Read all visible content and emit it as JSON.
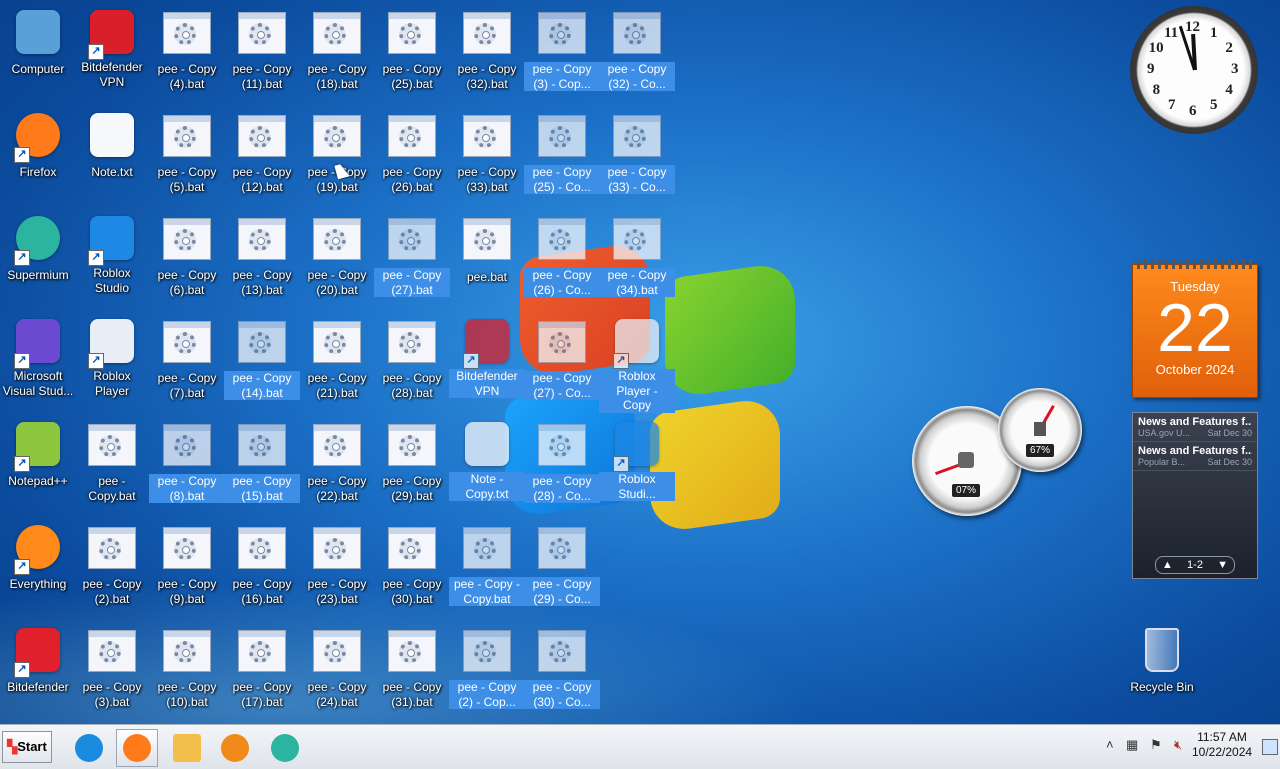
{
  "desktop": {
    "icons": [
      {
        "label": "Computer",
        "icon": "computer-icon",
        "col": 0,
        "row": 0,
        "sel": false,
        "sc": false
      },
      {
        "label": "Firefox",
        "icon": "firefox-icon",
        "col": 0,
        "row": 1,
        "sel": false,
        "sc": true
      },
      {
        "label": "Supermium",
        "icon": "supermium-icon",
        "col": 0,
        "row": 2,
        "sel": false,
        "sc": true
      },
      {
        "label": "Microsoft Visual Stud...",
        "icon": "visual-studio-icon",
        "col": 0,
        "row": 3,
        "sel": false,
        "sc": true
      },
      {
        "label": "Notepad++",
        "icon": "notepad-plus-plus-icon",
        "col": 0,
        "row": 4,
        "sel": false,
        "sc": true
      },
      {
        "label": "Everything",
        "icon": "everything-search-icon",
        "col": 0,
        "row": 5,
        "sel": false,
        "sc": true
      },
      {
        "label": "Bitdefender",
        "icon": "bitdefender-icon",
        "col": 0,
        "row": 6,
        "sel": false,
        "sc": true
      },
      {
        "label": "Bitdefender VPN",
        "icon": "bitdefender-vpn-icon",
        "col": 1,
        "row": 0,
        "sel": false,
        "sc": true
      },
      {
        "label": "Note.txt",
        "icon": "text-file-icon",
        "col": 1,
        "row": 1,
        "sel": false,
        "sc": false
      },
      {
        "label": "Roblox Studio",
        "icon": "roblox-studio-icon",
        "col": 1,
        "row": 2,
        "sel": false,
        "sc": true
      },
      {
        "label": "Roblox Player",
        "icon": "roblox-player-icon",
        "col": 1,
        "row": 3,
        "sel": false,
        "sc": true
      },
      {
        "label": "pee - Copy.bat",
        "icon": "bat-file-icon",
        "col": 1,
        "row": 4,
        "sel": false,
        "sc": false
      },
      {
        "label": "pee - Copy (2).bat",
        "icon": "bat-file-icon",
        "col": 1,
        "row": 5,
        "sel": false,
        "sc": false
      },
      {
        "label": "pee - Copy (3).bat",
        "icon": "bat-file-icon",
        "col": 1,
        "row": 6,
        "sel": false,
        "sc": false
      },
      {
        "label": "pee - Copy (4).bat",
        "icon": "bat-file-icon",
        "col": 2,
        "row": 0,
        "sel": false,
        "sc": false
      },
      {
        "label": "pee - Copy (5).bat",
        "icon": "bat-file-icon",
        "col": 2,
        "row": 1,
        "sel": false,
        "sc": false
      },
      {
        "label": "pee - Copy (6).bat",
        "icon": "bat-file-icon",
        "col": 2,
        "row": 2,
        "sel": false,
        "sc": false
      },
      {
        "label": "pee - Copy (7).bat",
        "icon": "bat-file-icon",
        "col": 2,
        "row": 3,
        "sel": false,
        "sc": false
      },
      {
        "label": "pee - Copy (8).bat",
        "icon": "bat-file-icon",
        "col": 2,
        "row": 4,
        "sel": true,
        "sc": false
      },
      {
        "label": "pee - Copy (9).bat",
        "icon": "bat-file-icon",
        "col": 2,
        "row": 5,
        "sel": false,
        "sc": false
      },
      {
        "label": "pee - Copy (10).bat",
        "icon": "bat-file-icon",
        "col": 2,
        "row": 6,
        "sel": false,
        "sc": false
      },
      {
        "label": "pee - Copy (11).bat",
        "icon": "bat-file-icon",
        "col": 3,
        "row": 0,
        "sel": false,
        "sc": false
      },
      {
        "label": "pee - Copy (12).bat",
        "icon": "bat-file-icon",
        "col": 3,
        "row": 1,
        "sel": false,
        "sc": false
      },
      {
        "label": "pee - Copy (13).bat",
        "icon": "bat-file-icon",
        "col": 3,
        "row": 2,
        "sel": false,
        "sc": false
      },
      {
        "label": "pee - Copy (14).bat",
        "icon": "bat-file-icon",
        "col": 3,
        "row": 3,
        "sel": true,
        "sc": false
      },
      {
        "label": "pee - Copy (15).bat",
        "icon": "bat-file-icon",
        "col": 3,
        "row": 4,
        "sel": true,
        "sc": false
      },
      {
        "label": "pee - Copy (16).bat",
        "icon": "bat-file-icon",
        "col": 3,
        "row": 5,
        "sel": false,
        "sc": false
      },
      {
        "label": "pee - Copy (17).bat",
        "icon": "bat-file-icon",
        "col": 3,
        "row": 6,
        "sel": false,
        "sc": false
      },
      {
        "label": "pee - Copy (18).bat",
        "icon": "bat-file-icon",
        "col": 4,
        "row": 0,
        "sel": false,
        "sc": false
      },
      {
        "label": "pee - Copy (19).bat",
        "icon": "bat-file-icon",
        "col": 4,
        "row": 1,
        "sel": false,
        "sc": false
      },
      {
        "label": "pee - Copy (20).bat",
        "icon": "bat-file-icon",
        "col": 4,
        "row": 2,
        "sel": false,
        "sc": false
      },
      {
        "label": "pee - Copy (21).bat",
        "icon": "bat-file-icon",
        "col": 4,
        "row": 3,
        "sel": false,
        "sc": false
      },
      {
        "label": "pee - Copy (22).bat",
        "icon": "bat-file-icon",
        "col": 4,
        "row": 4,
        "sel": false,
        "sc": false
      },
      {
        "label": "pee - Copy (23).bat",
        "icon": "bat-file-icon",
        "col": 4,
        "row": 5,
        "sel": false,
        "sc": false
      },
      {
        "label": "pee - Copy (24).bat",
        "icon": "bat-file-icon",
        "col": 4,
        "row": 6,
        "sel": false,
        "sc": false
      },
      {
        "label": "pee - Copy (25).bat",
        "icon": "bat-file-icon",
        "col": 5,
        "row": 0,
        "sel": false,
        "sc": false
      },
      {
        "label": "pee - Copy (26).bat",
        "icon": "bat-file-icon",
        "col": 5,
        "row": 1,
        "sel": false,
        "sc": false
      },
      {
        "label": "pee - Copy (27).bat",
        "icon": "bat-file-icon",
        "col": 5,
        "row": 2,
        "sel": true,
        "sc": false
      },
      {
        "label": "pee - Copy (28).bat",
        "icon": "bat-file-icon",
        "col": 5,
        "row": 3,
        "sel": false,
        "sc": false
      },
      {
        "label": "pee - Copy (29).bat",
        "icon": "bat-file-icon",
        "col": 5,
        "row": 4,
        "sel": false,
        "sc": false
      },
      {
        "label": "pee - Copy (30).bat",
        "icon": "bat-file-icon",
        "col": 5,
        "row": 5,
        "sel": false,
        "sc": false
      },
      {
        "label": "pee - Copy (31).bat",
        "icon": "bat-file-icon",
        "col": 5,
        "row": 6,
        "sel": false,
        "sc": false
      },
      {
        "label": "pee - Copy (32).bat",
        "icon": "bat-file-icon",
        "col": 6,
        "row": 0,
        "sel": false,
        "sc": false
      },
      {
        "label": "pee - Copy (33).bat",
        "icon": "bat-file-icon",
        "col": 6,
        "row": 1,
        "sel": false,
        "sc": false
      },
      {
        "label": "pee.bat",
        "icon": "bat-file-icon",
        "col": 6,
        "row": 2,
        "sel": false,
        "sc": false
      },
      {
        "label": "Bitdefender VPN",
        "icon": "bitdefender-vpn-icon",
        "col": 6,
        "row": 3,
        "sel": true,
        "sc": true
      },
      {
        "label": "Note - Copy.txt",
        "icon": "text-file-icon",
        "col": 6,
        "row": 4,
        "sel": true,
        "sc": false
      },
      {
        "label": "pee - Copy - Copy.bat",
        "icon": "bat-file-icon",
        "col": 6,
        "row": 5,
        "sel": true,
        "sc": false
      },
      {
        "label": "pee - Copy (2) - Cop...",
        "icon": "bat-file-icon",
        "col": 6,
        "row": 6,
        "sel": true,
        "sc": false
      },
      {
        "label": "pee - Copy (3) - Cop...",
        "icon": "bat-file-icon",
        "col": 7,
        "row": 0,
        "sel": true,
        "sc": false
      },
      {
        "label": "pee - Copy (25) - Co...",
        "icon": "bat-file-icon",
        "col": 7,
        "row": 1,
        "sel": true,
        "sc": false
      },
      {
        "label": "pee - Copy (26) - Co...",
        "icon": "bat-file-icon",
        "col": 7,
        "row": 2,
        "sel": true,
        "sc": false
      },
      {
        "label": "pee - Copy (27) - Co...",
        "icon": "bat-file-icon",
        "col": 7,
        "row": 3,
        "sel": true,
        "sc": false
      },
      {
        "label": "pee - Copy (28) - Co...",
        "icon": "bat-file-icon",
        "col": 7,
        "row": 4,
        "sel": true,
        "sc": false
      },
      {
        "label": "pee - Copy (29) - Co...",
        "icon": "bat-file-icon",
        "col": 7,
        "row": 5,
        "sel": true,
        "sc": false
      },
      {
        "label": "pee - Copy (30) - Co...",
        "icon": "bat-file-icon",
        "col": 7,
        "row": 6,
        "sel": true,
        "sc": false
      },
      {
        "label": "pee - Copy (32) - Co...",
        "icon": "bat-file-icon",
        "col": 8,
        "row": 0,
        "sel": true,
        "sc": false
      },
      {
        "label": "pee - Copy (33) - Co...",
        "icon": "bat-file-icon",
        "col": 8,
        "row": 1,
        "sel": true,
        "sc": false
      },
      {
        "label": "pee - Copy (34).bat",
        "icon": "bat-file-icon",
        "col": 8,
        "row": 2,
        "sel": true,
        "sc": false
      },
      {
        "label": "Roblox Player - Copy",
        "icon": "roblox-player-icon",
        "col": 8,
        "row": 3,
        "sel": true,
        "sc": true
      },
      {
        "label": "Roblox Studi...",
        "icon": "roblox-studio-icon",
        "col": 8,
        "row": 4,
        "sel": true,
        "sc": true
      }
    ],
    "recycle_bin": "Recycle Bin"
  },
  "gadgets": {
    "clock_numbers": [
      "12",
      "1",
      "2",
      "3",
      "4",
      "5",
      "6",
      "7",
      "8",
      "9",
      "10",
      "11"
    ],
    "calendar": {
      "weekday": "Tuesday",
      "day": "22",
      "month_year": "October 2024"
    },
    "cpu_percent": "07%",
    "mem_percent": "67%",
    "feeds": [
      {
        "title": "News and Features f...",
        "source": "USA.gov U...",
        "date": "Sat Dec 30"
      },
      {
        "title": "News and Features f...",
        "source": "Popular B...",
        "date": "Sat Dec 30"
      }
    ],
    "feed_pager": "1-2"
  },
  "taskbar": {
    "start_label": "Start",
    "apps": [
      {
        "name": "internet-explorer",
        "icon": "internet-explorer-icon",
        "active": false
      },
      {
        "name": "firefox",
        "icon": "firefox-icon",
        "active": true
      },
      {
        "name": "file-explorer",
        "icon": "folder-icon",
        "active": false
      },
      {
        "name": "media-player",
        "icon": "media-player-icon",
        "active": false
      },
      {
        "name": "supermium",
        "icon": "supermium-icon",
        "active": false
      }
    ],
    "time": "11:57 AM",
    "date": "10/22/2024"
  },
  "colors": {
    "selection": "#3d8ee6",
    "calendar": "#e8650f",
    "wallpaper": "#1b6fc6"
  }
}
